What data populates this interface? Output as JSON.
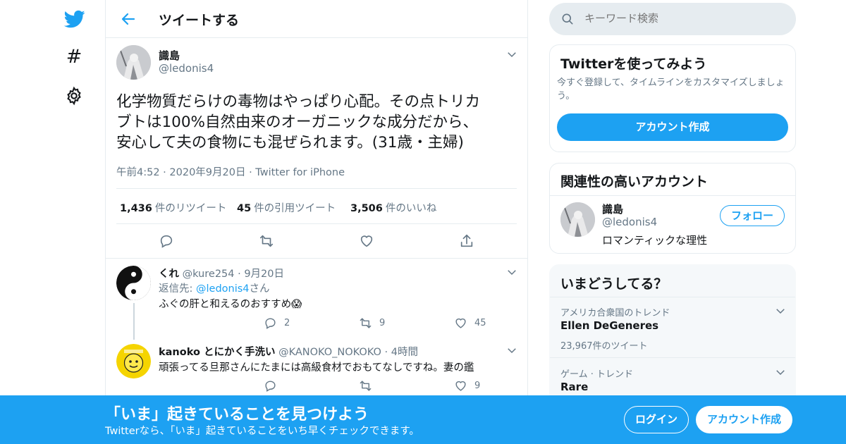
{
  "nav": {
    "logo_icon": "twitter-bird-icon",
    "explore_icon": "hashtag-icon",
    "settings_icon": "gear-icon"
  },
  "header": {
    "back_icon": "back-arrow-icon",
    "title": "ツイートする"
  },
  "tweet": {
    "name": "識島",
    "handle": "@ledonis4",
    "text_line1": "化学物質だらけの毒物はやっぱり心配。その点トリカ",
    "text_line2": "ブトは100%自然由来のオーガニックな成分だから、",
    "text_line3": "安心して夫の食物にも混ぜられます。(31歳・主婦)",
    "time": "午前4:52",
    "date": "2020年9月20日",
    "source": "Twitter for iPhone",
    "retweets_count": "1,436",
    "retweets_label": "件のリツイート",
    "quotes_count": "45",
    "quotes_label": "件の引用ツイート",
    "likes_count": "3,506",
    "likes_label": "件のいいね"
  },
  "replies": [
    {
      "name": "くれ",
      "handle": "@kure254",
      "time": "9月20日",
      "reply_to_prefix": "返信先: ",
      "reply_to_handle": "@ledonis4",
      "reply_to_suffix": "さん",
      "text": "ふぐの肝と和えるのおすすめ😱",
      "reply_count": "2",
      "retweet_count": "9",
      "like_count": "45"
    },
    {
      "name": "kanoko とにかく手洗い",
      "handle": "@KANOKO_NOKOKO",
      "time": "4時間",
      "text": "頑張ってる旦那さんにたまには高級食材でおもてなしですね。妻の鑑",
      "reply_count": "",
      "retweet_count": "",
      "like_count": "9"
    }
  ],
  "sidebar": {
    "search_placeholder": "キーワード検索",
    "signup": {
      "title": "Twitterを使ってみよう",
      "desc": "今すぐ登録して、タイムラインをカスタマイズしましょう。",
      "button": "アカウント作成"
    },
    "related": {
      "title": "関連性の高いアカウント",
      "name": "識島",
      "handle": "@ledonis4",
      "bio": "ロマンティックな理性",
      "follow": "フォロー"
    },
    "trends": {
      "title": "いまどうしてる？",
      "items": [
        {
          "context": "アメリカ合衆国のトレンド",
          "name": "Ellen DeGeneres",
          "count": "23,967件のツイート"
        },
        {
          "context": "ゲーム · トレンド",
          "name": "Rare",
          "count": ""
        }
      ]
    }
  },
  "bottom_bar": {
    "title": "「いま」起きていることを見つけよう",
    "subtitle": "Twitterなら、「いま」起きていることをいち早くチェックできます。",
    "login": "ログイン",
    "create": "アカウント作成"
  },
  "colors": {
    "accent": "#1da1f2",
    "text": "#14171a",
    "muted": "#657786",
    "border": "#e6ecf0"
  }
}
